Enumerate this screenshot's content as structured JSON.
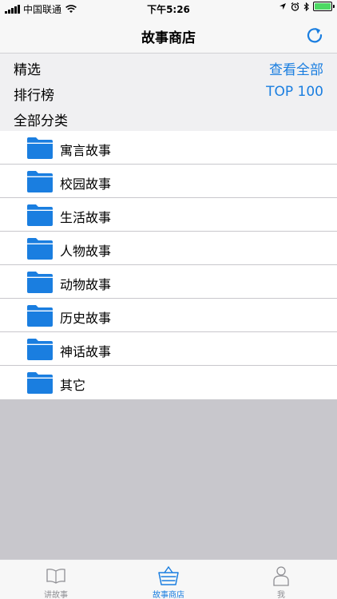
{
  "status_bar": {
    "carrier": "中国联通",
    "time": "下午5:26"
  },
  "nav": {
    "title": "故事商店",
    "refresh_icon": "refresh-icon"
  },
  "sections": {
    "featured_label": "精选",
    "featured_link": "查看全部",
    "ranking_label": "排行榜",
    "ranking_link": "TOP 100",
    "categories_label": "全部分类"
  },
  "categories": [
    {
      "label": "寓言故事",
      "icon": "folder-icon"
    },
    {
      "label": "校园故事",
      "icon": "folder-icon"
    },
    {
      "label": "生活故事",
      "icon": "folder-icon"
    },
    {
      "label": "人物故事",
      "icon": "folder-icon"
    },
    {
      "label": "动物故事",
      "icon": "folder-icon"
    },
    {
      "label": "历史故事",
      "icon": "folder-icon"
    },
    {
      "label": "神话故事",
      "icon": "folder-icon"
    },
    {
      "label": "其它",
      "icon": "folder-icon"
    }
  ],
  "tabs": [
    {
      "label": "讲故事",
      "icon": "book-icon",
      "active": false
    },
    {
      "label": "故事商店",
      "icon": "basket-icon",
      "active": true
    },
    {
      "label": "我",
      "icon": "person-icon",
      "active": false
    }
  ],
  "colors": {
    "accent": "#1a7ee0",
    "folder": "#1a7ee0",
    "inactive_tab": "#8e8e93",
    "empty_area": "#c8c7cc",
    "battery": "#4cd964"
  }
}
